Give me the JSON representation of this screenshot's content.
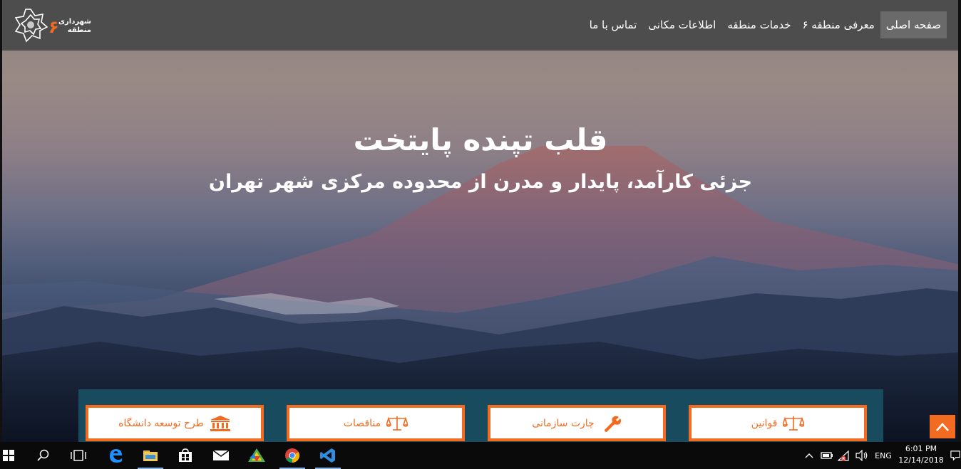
{
  "header": {
    "logo": {
      "text": "شهرداری منطقه",
      "number": "۶"
    },
    "nav": [
      {
        "label": "صفحه اصلی",
        "active": true
      },
      {
        "label": "معرفی منطقه ۶",
        "active": false
      },
      {
        "label": "خدمات منطقه",
        "active": false
      },
      {
        "label": "اطلاعات مکانی",
        "active": false
      },
      {
        "label": "تماس با ما",
        "active": false
      }
    ]
  },
  "hero": {
    "title": "قلب تپنده پایتخت",
    "subtitle": "جزئی کارآمد، پایدار و مدرن از محدوده مرکزی شهر تهران"
  },
  "cards": [
    {
      "label": "قوانین",
      "icon": "scales-icon"
    },
    {
      "label": "چارت سازمانی",
      "icon": "wrench-icon"
    },
    {
      "label": "مناقصات",
      "icon": "scales-icon"
    },
    {
      "label": "طرح توسعه دانشگاه",
      "icon": "institution-icon"
    }
  ],
  "scroll_top": {
    "icon": "chevron-up-icon"
  },
  "taskbar": {
    "apps": [
      {
        "name": "start-icon"
      },
      {
        "name": "search-icon"
      },
      {
        "name": "task-view-icon"
      },
      {
        "name": "edge-icon"
      },
      {
        "name": "file-explorer-icon"
      },
      {
        "name": "store-icon"
      },
      {
        "name": "mail-icon"
      },
      {
        "name": "app-icon"
      },
      {
        "name": "chrome-icon"
      },
      {
        "name": "vscode-icon"
      }
    ],
    "tray": {
      "language": "ENG",
      "time": "6:01 PM",
      "date": "12/14/2018"
    }
  },
  "colors": {
    "accent": "#f36b21",
    "navbar": "#4d4d4d",
    "panel": "#184b5e"
  }
}
